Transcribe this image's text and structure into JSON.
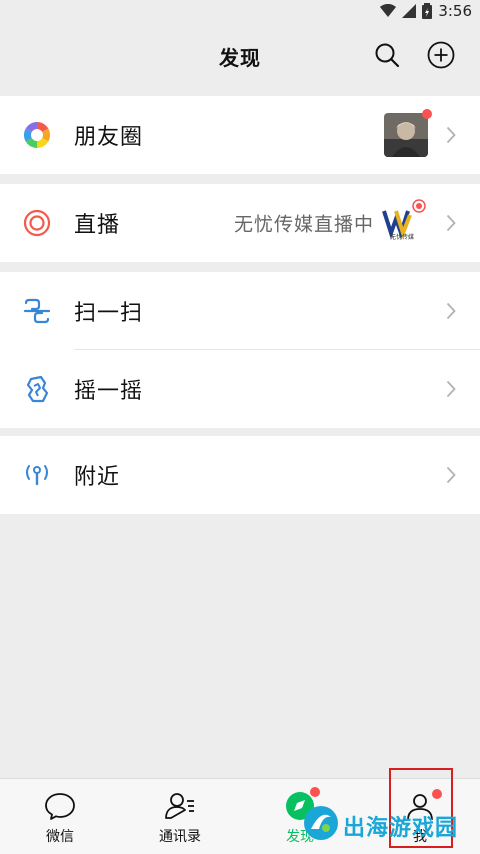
{
  "status_bar": {
    "time": "3:56",
    "icons": [
      "wifi-icon",
      "signal-icon",
      "battery-icon"
    ]
  },
  "header": {
    "title": "发现",
    "icons": [
      "search-icon",
      "add-icon"
    ]
  },
  "moments": {
    "label": "朋友圈",
    "icon": "moments-icon",
    "has_new": true
  },
  "live": {
    "label": "直播",
    "icon": "live-icon",
    "status_text": "无忧传媒直播中",
    "logo_text": "无忧传媒"
  },
  "scan": {
    "label": "扫一扫",
    "icon": "scan-icon"
  },
  "shake": {
    "label": "摇一摇",
    "icon": "shake-icon"
  },
  "nearby": {
    "label": "附近",
    "icon": "nearby-icon"
  },
  "tabbar": {
    "tabs": [
      {
        "label": "微信",
        "icon": "chat-icon"
      },
      {
        "label": "通讯录",
        "icon": "contacts-icon"
      },
      {
        "label": "发现",
        "icon": "discover-icon",
        "has_badge": true
      },
      {
        "label": "我",
        "icon": "me-icon",
        "has_badge": true
      }
    ]
  },
  "watermark": {
    "text": "出海游戏园"
  },
  "colors": {
    "background": "#ededed",
    "card": "#ffffff",
    "badge": "#fa5151",
    "accent": "#07c160",
    "highlight": "#d71f1f",
    "watermark": "#1aa7d8"
  }
}
